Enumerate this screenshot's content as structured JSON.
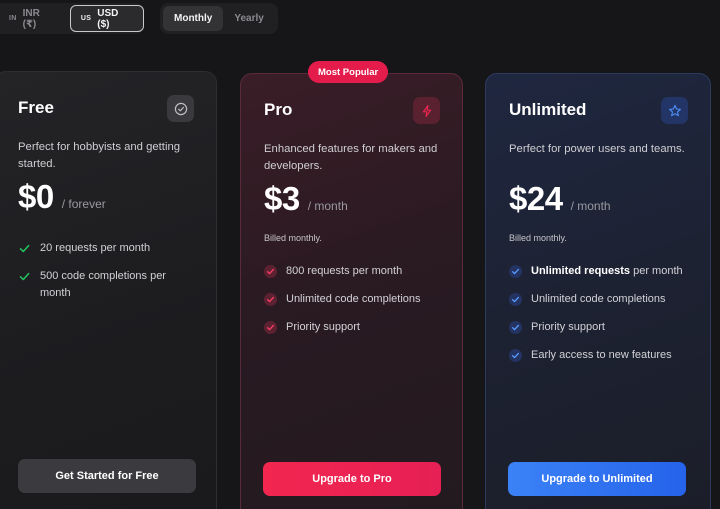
{
  "currency": {
    "options": [
      {
        "code": "IN",
        "label": "INR (₹)"
      },
      {
        "code": "US",
        "label": "USD ($)"
      }
    ],
    "selected": "USD ($)"
  },
  "billing": {
    "options": [
      "Monthly",
      "Yearly"
    ],
    "selected": "Monthly"
  },
  "plans": [
    {
      "name": "Free",
      "icon": "check-circle-icon",
      "description": "Perfect for hobbyists and getting started.",
      "price": "$0",
      "period": "/ forever",
      "billed": "",
      "features": [
        "20 requests per month",
        "500 code completions per month"
      ],
      "cta": "Get Started for Free"
    },
    {
      "name": "Pro",
      "icon": "lightning-icon",
      "badge": "Most Popular",
      "description": "Enhanced features for makers and developers.",
      "price": "$3",
      "period": "/ month",
      "billed": "Billed monthly.",
      "features": [
        "800 requests per month",
        "Unlimited code completions",
        "Priority support"
      ],
      "cta": "Upgrade to Pro"
    },
    {
      "name": "Unlimited",
      "icon": "star-icon",
      "description": "Perfect for power users and teams.",
      "price": "$24",
      "period": "/ month",
      "billed": "Billed monthly.",
      "features_bold": "Unlimited requests",
      "features": [
        " per month",
        "Unlimited code completions",
        "Priority support",
        "Early access to new features"
      ],
      "cta": "Upgrade to Unlimited"
    }
  ],
  "colors": {
    "background": "#161618",
    "pro_accent": "#f2264f",
    "unlimited_accent": "#3b82f6",
    "free_check": "#22c55e"
  }
}
